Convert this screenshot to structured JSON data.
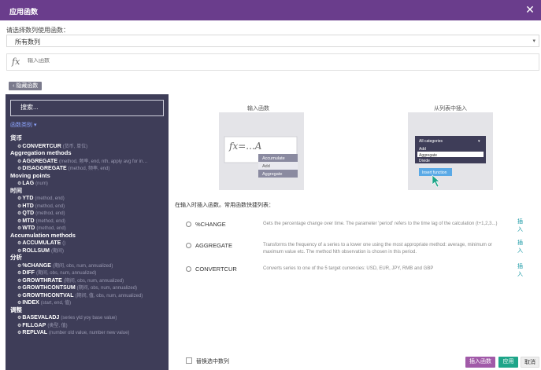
{
  "dialog": {
    "title": "应用函数",
    "close_glyph": "✕"
  },
  "series": {
    "label": "请选择数列使用函数：",
    "selected": "所有数列"
  },
  "formula": {
    "fx": "fx",
    "placeholder": "输入函数"
  },
  "hide_button": "‹ 隐藏函数",
  "sidebar": {
    "search_placeholder": "搜索...",
    "categories_toggle": "函数类别 ▾",
    "rows": [
      {
        "type": "group",
        "label": "货币"
      },
      {
        "type": "func",
        "name": "CONVERTCUR",
        "args": "(货币, 单位)"
      },
      {
        "type": "group",
        "label": "Aggregation methods"
      },
      {
        "type": "func",
        "name": "AGGREGATE",
        "args": "(method, 频率, end, nth, apply avg for in…"
      },
      {
        "type": "func",
        "name": "DISAGGREGATE",
        "args": "(method, 频率, end)"
      },
      {
        "type": "group",
        "label": "Moving points"
      },
      {
        "type": "func",
        "name": "LAG",
        "args": "(num)"
      },
      {
        "type": "group",
        "label": "时间"
      },
      {
        "type": "func",
        "name": "YTD",
        "args": "(method, end)"
      },
      {
        "type": "func",
        "name": "HTD",
        "args": "(method, end)"
      },
      {
        "type": "func",
        "name": "QTD",
        "args": "(method, end)"
      },
      {
        "type": "func",
        "name": "MTD",
        "args": "(method, end)"
      },
      {
        "type": "func",
        "name": "WTD",
        "args": "(method, end)"
      },
      {
        "type": "group",
        "label": "Accumulation methods"
      },
      {
        "type": "func",
        "name": "ACCUMULATE",
        "args": "()"
      },
      {
        "type": "func",
        "name": "ROLLSUM",
        "args": "(期间)"
      },
      {
        "type": "group",
        "label": "分析"
      },
      {
        "type": "func",
        "name": "%CHANGE",
        "args": "(期间, obs, num, annualized)"
      },
      {
        "type": "func",
        "name": "DIFF",
        "args": "(期间, obs, num, annualized)"
      },
      {
        "type": "func",
        "name": "GROWTHRATE",
        "args": "(期间, obs, num, annualized)"
      },
      {
        "type": "func",
        "name": "GROWTHCONTSUM",
        "args": "(期间, obs, num, annualized)"
      },
      {
        "type": "func",
        "name": "GROWTHCONTVAL",
        "args": "(期间, 值, obs, num, annualized)"
      },
      {
        "type": "func",
        "name": "INDEX",
        "args": "(start, end, 值)"
      },
      {
        "type": "group",
        "label": "调整"
      },
      {
        "type": "func",
        "name": "BASEVALADJ",
        "args": "(series yld yoy base value)"
      },
      {
        "type": "func",
        "name": "FILLGAP",
        "args": "(类型, 值)"
      },
      {
        "type": "func",
        "name": "REPLVAL",
        "args": "(number old value, number new value)"
      }
    ]
  },
  "input_panel": {
    "caption": "输入函数",
    "fx_text": "fx=...A",
    "menu": [
      "Accumulate",
      "Add",
      "Aggregate"
    ]
  },
  "list_panel": {
    "caption": "从列表中插入",
    "dropdown_value": "All categories",
    "options": [
      "Add",
      "Aggregate",
      "Divide"
    ],
    "insert_button": "Insert function"
  },
  "quick": {
    "help": "在输入时插入函数。常用函数快捷列表：",
    "insert_label": "插入",
    "items": [
      {
        "name": "%CHANGE",
        "desc": "Gets the percentage change over time. The parameter 'period' refers to the time lag of the calculation (t+1,2,3...)"
      },
      {
        "name": "AGGREGATE",
        "desc": "Transforms the frequency of a series to a lower one using the most appropriate method: average, minimum or maximum value etc. The method Nth observation is chosen in this period."
      },
      {
        "name": "CONVERTCUR",
        "desc": "Converts series to one of the 5 target currencies: USD, EUR, JPY, RMB and GBP"
      }
    ]
  },
  "footer": {
    "replace_label": "替换选中数列",
    "insert_fn": "插入函数",
    "apply": "应用",
    "cancel": "取消"
  },
  "colors": {
    "title_bar": "#6a3d8c",
    "sidebar_bg": "#3e3d58",
    "link": "#1a9aa6",
    "insert_fn_btn": "#a15aa8",
    "apply_btn": "#1ea589"
  }
}
